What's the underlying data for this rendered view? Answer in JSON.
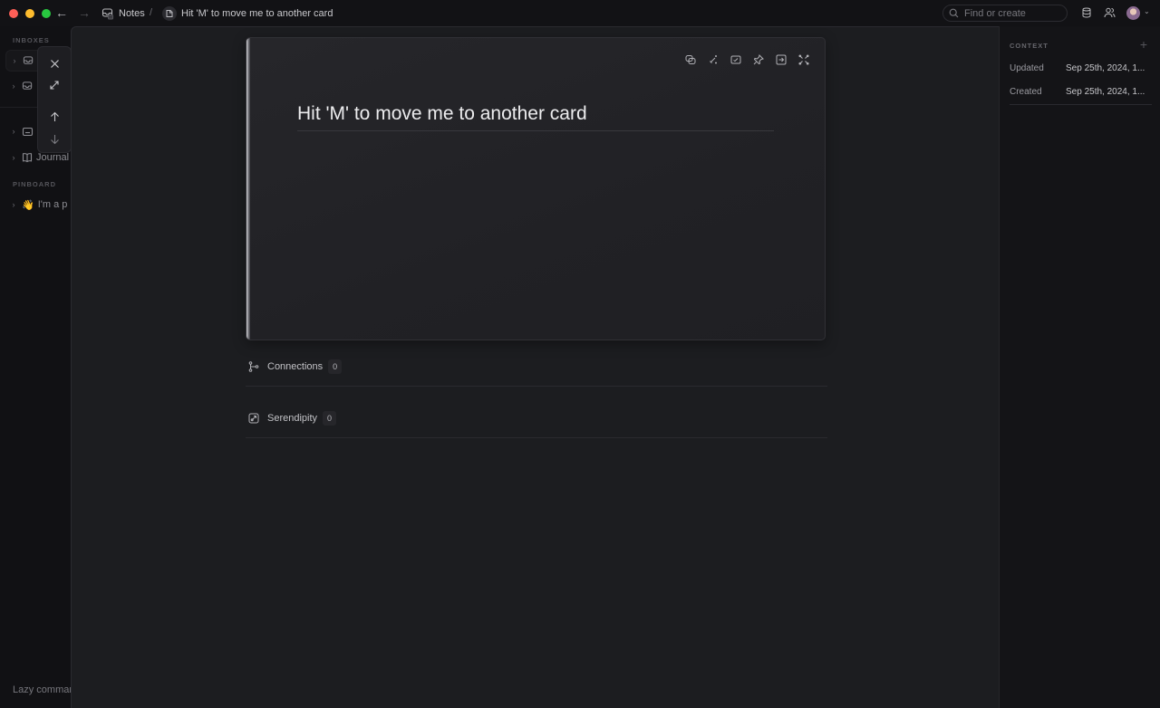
{
  "titlebar": {
    "breadcrumbs": [
      {
        "label": "Notes",
        "icon": "inbox-icon"
      },
      {
        "label": "Hit 'M' to move me to another card",
        "icon": "note-icon"
      }
    ],
    "separator": "/",
    "search_placeholder": "Find or create",
    "icons": [
      "database-icon",
      "users-icon",
      "avatar"
    ]
  },
  "sidebar": {
    "sections": [
      {
        "heading": "INBOXES"
      },
      {
        "heading": "PINBOARD"
      }
    ],
    "items": [
      {
        "label": "",
        "icon": "inbox-icon"
      },
      {
        "label": "",
        "icon": "inbox-icon"
      },
      {
        "label": "",
        "icon": "card-icon"
      },
      {
        "label": "Journal",
        "icon": "book-icon"
      },
      {
        "label": "I'm a p",
        "icon": "👋"
      }
    ],
    "footer": "Lazy commands"
  },
  "palette": {
    "buttons": [
      "close",
      "expand",
      "previous",
      "next"
    ]
  },
  "card": {
    "title": "Hit 'M' to move me to another card",
    "toolbar": [
      "link-icon",
      "sparkle-icon",
      "image-icon",
      "pin-icon",
      "move-icon",
      "focus-icon"
    ]
  },
  "sections": {
    "connections": {
      "label": "Connections",
      "count": "0"
    },
    "serendipity": {
      "label": "Serendipity",
      "count": "0"
    }
  },
  "context": {
    "heading": "CONTEXT",
    "add": "+",
    "rows": [
      {
        "label": "Updated",
        "value": "Sep 25th, 2024, 1..."
      },
      {
        "label": "Created",
        "value": "Sep 25th, 2024, 1..."
      }
    ]
  }
}
